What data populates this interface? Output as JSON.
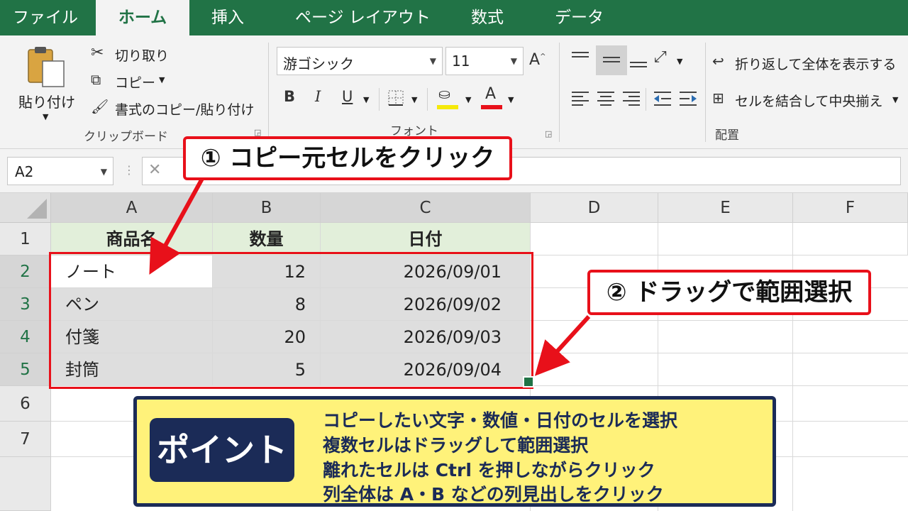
{
  "tabs": [
    "ファイル",
    "ホーム",
    "挿入",
    "ページ レイアウト",
    "数式",
    "データ"
  ],
  "clipboard": {
    "paste_label": "貼り付け",
    "cut_label": "切り取り",
    "copy_label": "コピー",
    "format_painter_label": "書式のコピー/貼り付け",
    "group_label": "クリップボード"
  },
  "font": {
    "name": "游ゴシック",
    "size": "11",
    "bold": "B",
    "italic": "I",
    "underline": "U",
    "font_color_glyph": "A",
    "group_label": "フォント",
    "fill_color": "#f5e90a",
    "text_color": "#e8101a"
  },
  "alignment": {
    "wrap_text_label": "折り返して全体を表示する",
    "merge_label": "セルを結合して中央揃え",
    "group_label": "配置"
  },
  "formula_bar": {
    "name_box": "A2",
    "cancel": "✕"
  },
  "sheet": {
    "columns": [
      "A",
      "B",
      "C",
      "D",
      "E",
      "F"
    ],
    "rows": [
      "1",
      "2",
      "3",
      "4",
      "5",
      "6",
      "7"
    ],
    "header": [
      "商品名",
      "数量",
      "日付"
    ],
    "data": [
      [
        "ノート",
        "12",
        "2026/09/01"
      ],
      [
        "ペン",
        "8",
        "2026/09/02"
      ],
      [
        "付箋",
        "20",
        "2026/09/03"
      ],
      [
        "封筒",
        "5",
        "2026/09/04"
      ]
    ]
  },
  "callouts": {
    "step1": "① コピー元セルをクリック",
    "step2": "② ドラッグで範囲選択"
  },
  "point": {
    "badge": "ポイント",
    "lines": [
      "コピーしたい文字・数値・日付のセルを選択",
      "複数セルはドラッグして範囲選択",
      "離れたセルは Ctrl を押しながらクリック",
      "列全体は A・B などの列見出しをクリック"
    ]
  },
  "colors": {
    "accent": "#217346",
    "highlight": "#e8101a",
    "header_fill": "#e2efda",
    "point_bg": "#fff27a",
    "point_border": "#1b2b57"
  }
}
